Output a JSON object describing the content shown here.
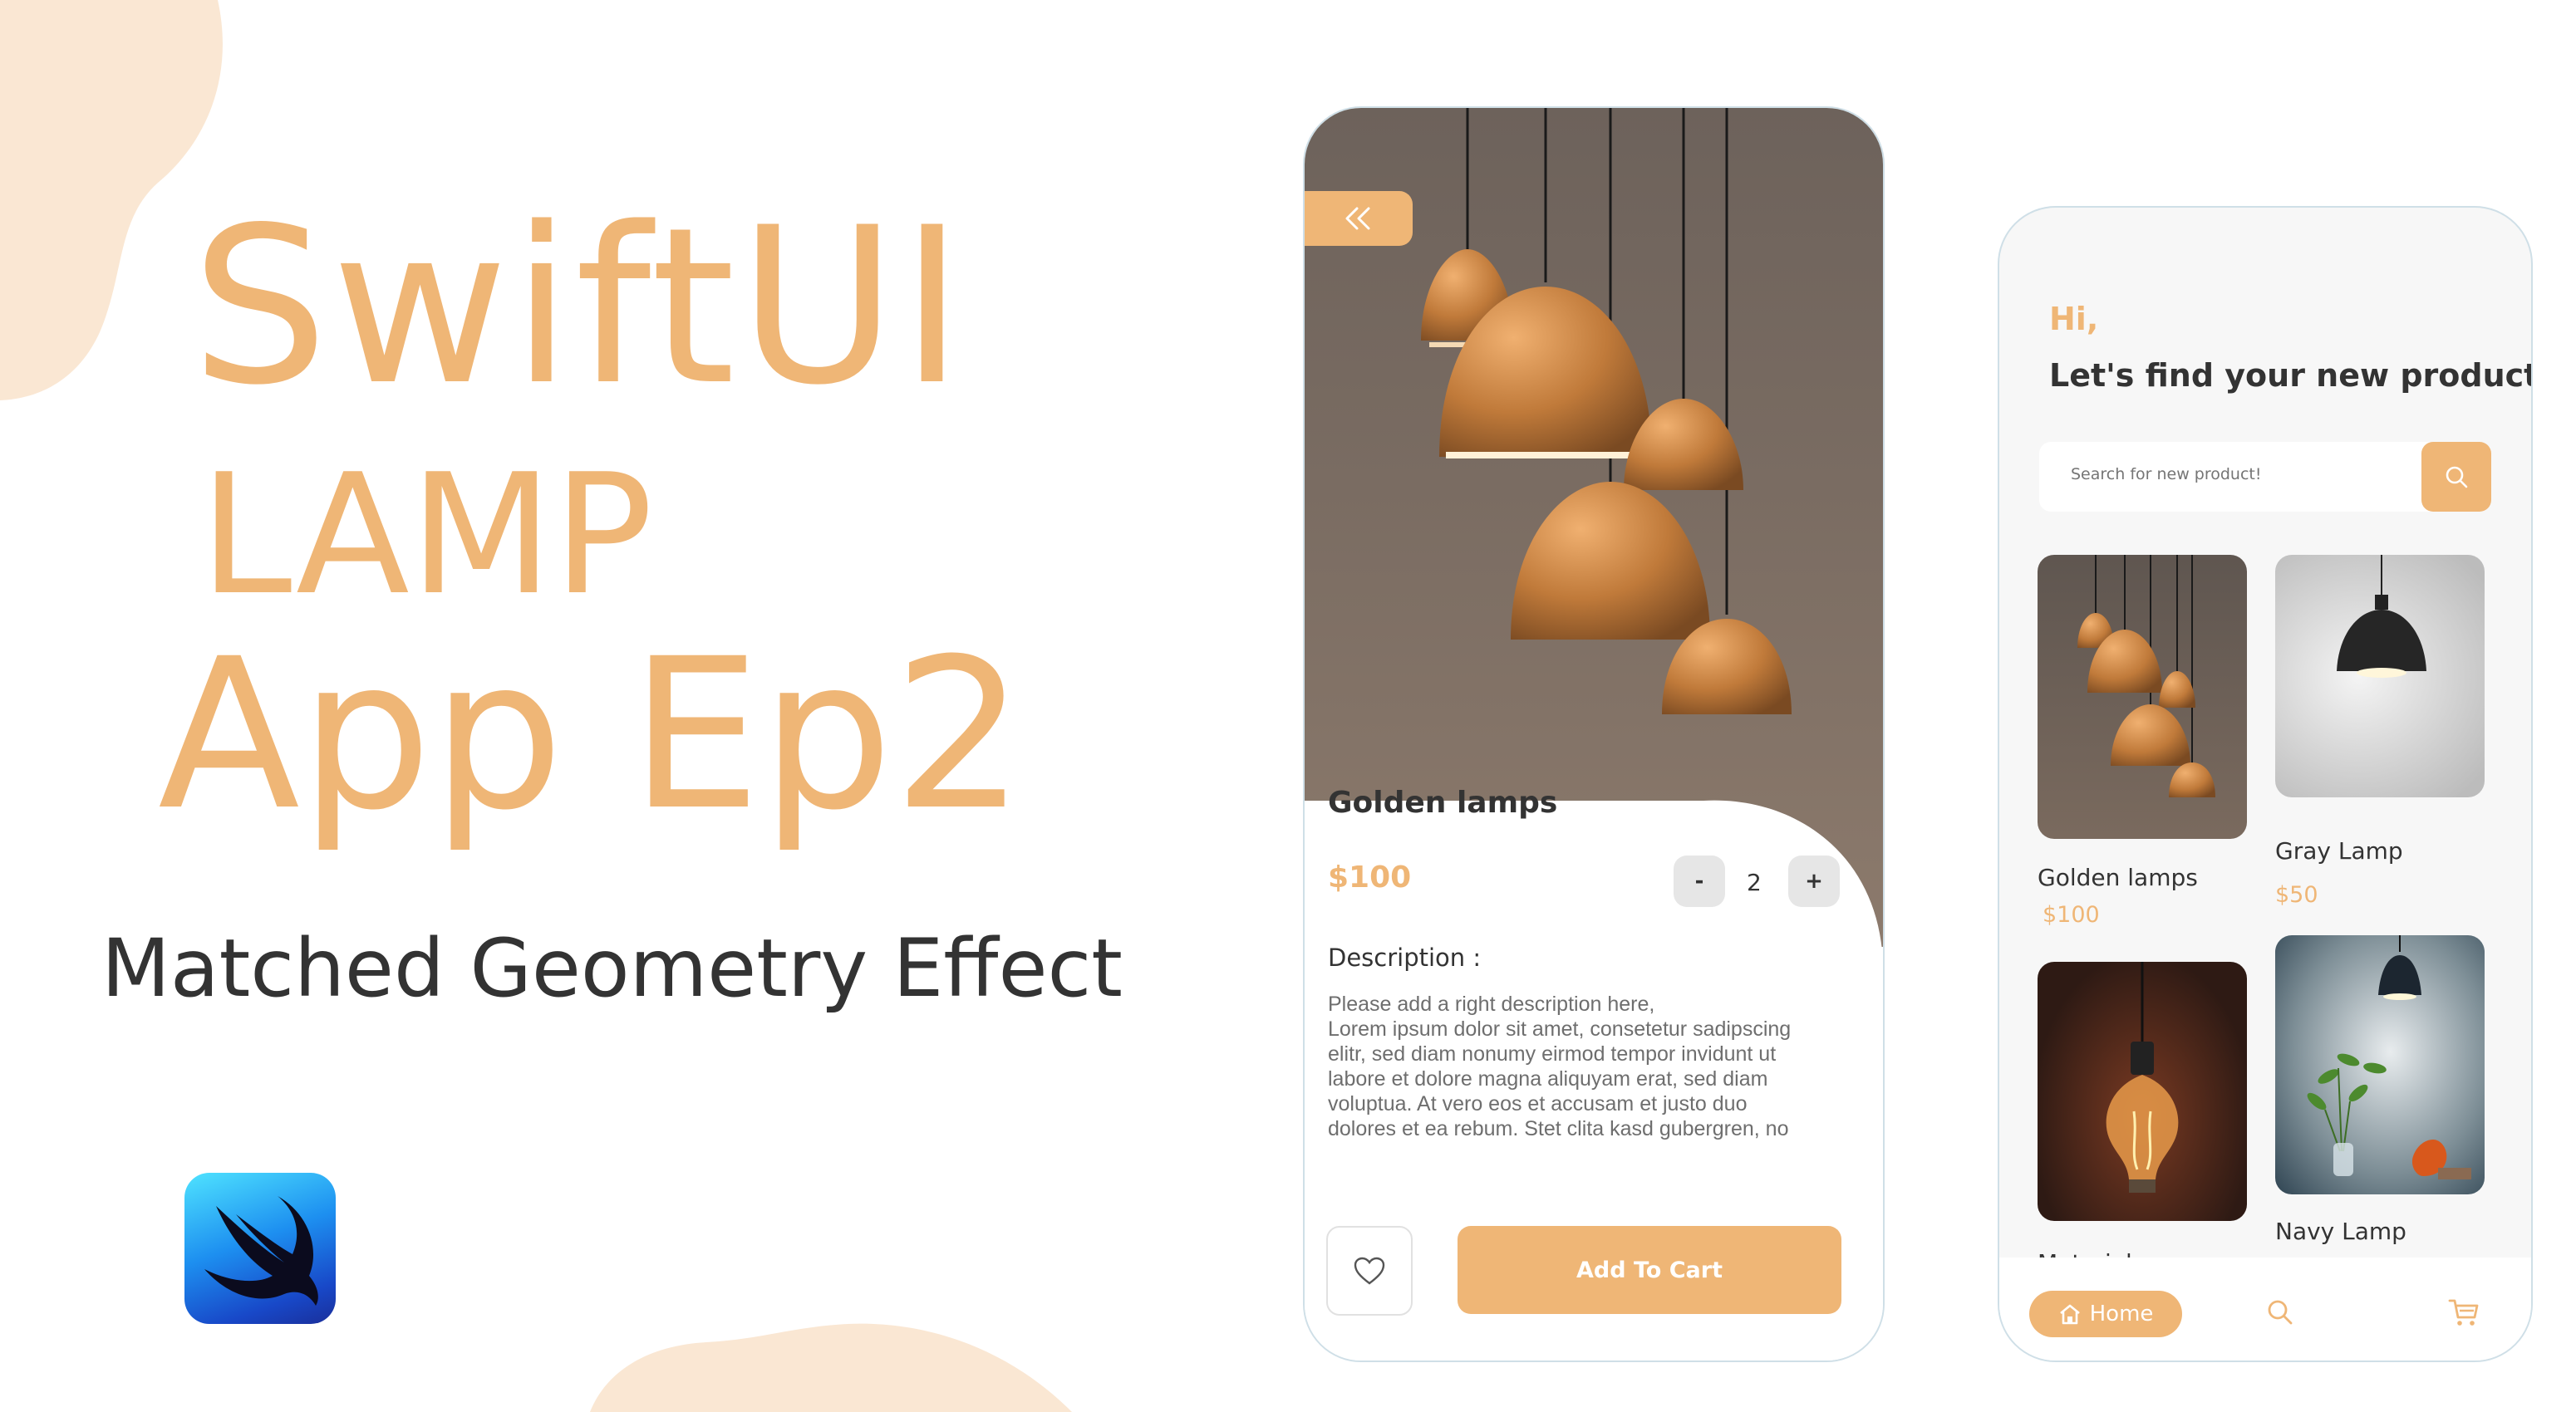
{
  "banner": {
    "title_line1": "SwiftUI",
    "title_line2": "LAMP",
    "title_line3": "App Ep2",
    "subtitle": "Matched Geometry Effect",
    "logo_icon": "swift-logo-icon"
  },
  "colors": {
    "accent": "#efb676",
    "blob": "#fae7d3",
    "text_dark": "#333333",
    "text_muted": "#6e6e6e",
    "border": "#cfdfe7"
  },
  "detail_screen": {
    "back_icon": "double-chevron-left-icon",
    "product_name": "Golden lamps",
    "price": "$100",
    "quantity": {
      "minus_label": "-",
      "value": "2",
      "plus_label": "+"
    },
    "description_title": "Description :",
    "description_text": "Please add a right description here,\nLorem ipsum dolor sit amet, consetetur sadipscing\nelitr, sed diam nonumy eirmod tempor invidunt ut\nlabore et dolore magna aliquyam erat, sed diam\nvoluptua. At vero eos et accusam et justo duo\ndolores et ea rebum. Stet clita kasd gubergren, no",
    "favorite_icon": "heart-icon",
    "add_to_cart_label": "Add To Cart"
  },
  "home_screen": {
    "greeting": "Hi,",
    "headline": "Let's find your new product",
    "search": {
      "placeholder": "Search for new product!",
      "icon": "search-icon"
    },
    "products": [
      {
        "name": "Golden lamps",
        "price": "$100"
      },
      {
        "name": "Gray Lamp",
        "price": "$50"
      },
      {
        "name": "Material",
        "price": ""
      },
      {
        "name": "Navy Lamp",
        "price": ""
      }
    ],
    "tabbar": {
      "home_label": "Home",
      "home_icon": "house-icon",
      "search_icon": "search-icon",
      "cart_icon": "cart-icon"
    }
  }
}
